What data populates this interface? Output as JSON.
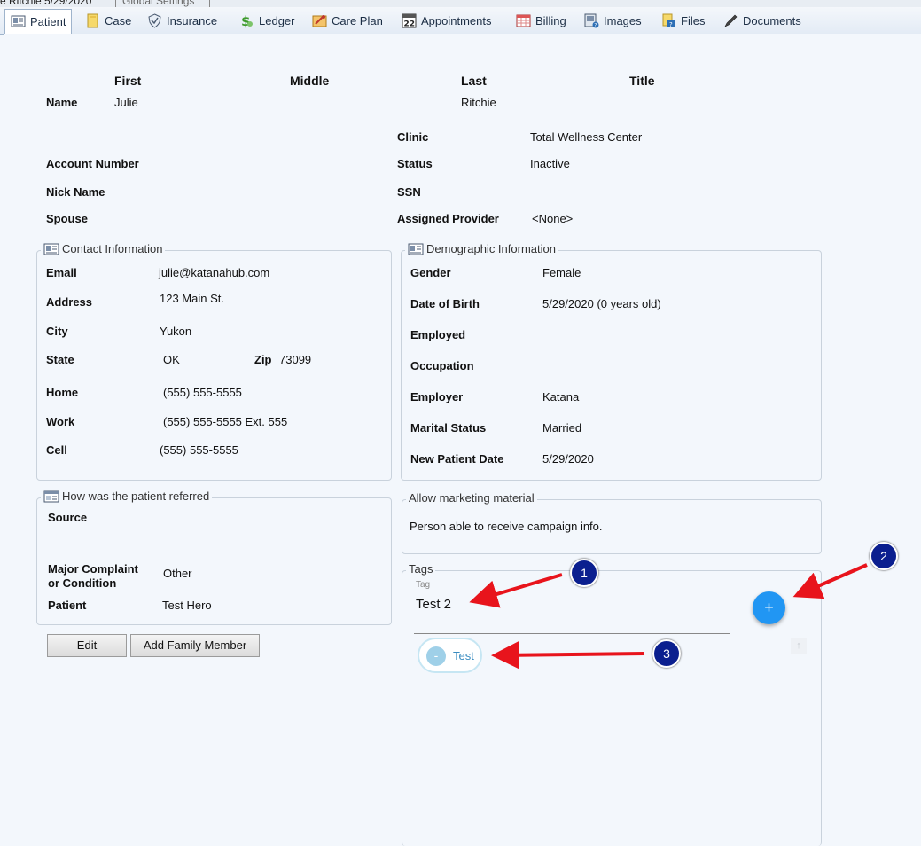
{
  "window": {
    "doc_tab_active": "e Ritchie 5/29/2020",
    "doc_tab_inactive": "Global Settings"
  },
  "tabs": [
    {
      "label": "Patient",
      "icon": "id-card-icon"
    },
    {
      "label": "Case",
      "icon": "folder-icon"
    },
    {
      "label": "Insurance",
      "icon": "shield-icon"
    },
    {
      "label": "Ledger",
      "icon": "money-icon"
    },
    {
      "label": "Care Plan",
      "icon": "care-plan-icon"
    },
    {
      "label": "Appointments",
      "icon": "calendar-icon"
    },
    {
      "label": "Billing",
      "icon": "billing-icon"
    },
    {
      "label": "Images",
      "icon": "images-icon"
    },
    {
      "label": "Files",
      "icon": "files-icon"
    },
    {
      "label": "Documents",
      "icon": "pen-icon"
    }
  ],
  "name_headers": {
    "first": "First",
    "middle": "Middle",
    "last": "Last",
    "title": "Title"
  },
  "name": {
    "label": "Name",
    "first": "Julie",
    "last": "Ritchie"
  },
  "info": {
    "clinic_label": "Clinic",
    "clinic_value": "Total Wellness Center",
    "account_label": "Account Number",
    "status_label": "Status",
    "status_value": "Inactive",
    "nick_label": "Nick Name",
    "ssn_label": "SSN",
    "spouse_label": "Spouse",
    "provider_label": "Assigned Provider",
    "provider_value": "<None>"
  },
  "contact": {
    "title": "Contact Information",
    "email_label": "Email",
    "email_value": "julie@katanahub.com",
    "address_label": "Address",
    "address_value": "123 Main St.",
    "city_label": "City",
    "city_value": "Yukon",
    "state_label": "State",
    "state_value": "OK",
    "zip_label": "Zip",
    "zip_value": "73099",
    "home_label": "Home",
    "home_value": "(555) 555-5555",
    "work_label": "Work",
    "work_value": "(555) 555-5555 Ext. 555",
    "cell_label": "Cell",
    "cell_value": "(555) 555-5555"
  },
  "demographic": {
    "title": "Demographic Information",
    "gender_label": "Gender",
    "gender_value": "Female",
    "dob_label": "Date of Birth",
    "dob_value": "5/29/2020 (0 years old)",
    "employed_label": "Employed",
    "occupation_label": "Occupation",
    "employer_label": "Employer",
    "employer_value": "Katana",
    "marital_label": "Marital Status",
    "marital_value": "Married",
    "new_patient_label": "New Patient Date",
    "new_patient_value": "5/29/2020"
  },
  "referral": {
    "title": "How was the patient referred",
    "source_label": "Source",
    "complaint_label_1": "Major Complaint",
    "complaint_label_2": "or Condition",
    "complaint_value": "Other",
    "patient_label": "Patient",
    "patient_value": "Test Hero"
  },
  "marketing": {
    "title": "Allow marketing material",
    "text": "Person able to receive campaign info."
  },
  "tags": {
    "title": "Tags",
    "input_label": "Tag",
    "input_value": "Test 2",
    "add_symbol": "+",
    "chip_remove": "-",
    "chip_label": "Test",
    "scroll_up": "↑"
  },
  "buttons": {
    "edit": "Edit",
    "add_family": "Add Family Member"
  },
  "markers": [
    "1",
    "2",
    "3"
  ],
  "colors": {
    "annotation_arrow": "#e8141c",
    "marker_circle": "#0b1f8f",
    "add_button": "#2196f3",
    "chip": "#58b4dd"
  }
}
